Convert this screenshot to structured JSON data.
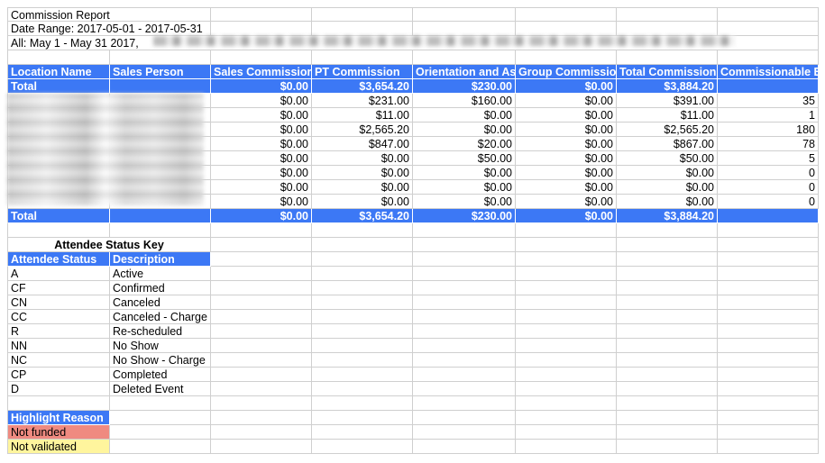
{
  "report": {
    "title": "Commission Report",
    "date_range": "Date Range: 2017-05-01 - 2017-05-31",
    "filter": "All: May 1 - May 31 2017,"
  },
  "commission_table": {
    "headers": [
      "Location Name",
      "Sales Person",
      "Sales Commissior",
      "PT Commission",
      "Orientation and As",
      "Group Commissio",
      "Total Commission",
      "Commissionable E"
    ],
    "total_top": [
      "Total",
      "",
      "$0.00",
      "$3,654.20",
      "$230.00",
      "$0.00",
      "$3,884.20",
      ""
    ],
    "rows": [
      [
        "",
        "",
        "$0.00",
        "$231.00",
        "$160.00",
        "$0.00",
        "$391.00",
        "35"
      ],
      [
        "",
        "",
        "$0.00",
        "$11.00",
        "$0.00",
        "$0.00",
        "$11.00",
        "1"
      ],
      [
        "",
        "",
        "$0.00",
        "$2,565.20",
        "$0.00",
        "$0.00",
        "$2,565.20",
        "180"
      ],
      [
        "",
        "",
        "$0.00",
        "$847.00",
        "$20.00",
        "$0.00",
        "$867.00",
        "78"
      ],
      [
        "",
        "",
        "$0.00",
        "$0.00",
        "$50.00",
        "$0.00",
        "$50.00",
        "5"
      ],
      [
        "",
        "",
        "$0.00",
        "$0.00",
        "$0.00",
        "$0.00",
        "$0.00",
        "0"
      ],
      [
        "",
        "",
        "$0.00",
        "$0.00",
        "$0.00",
        "$0.00",
        "$0.00",
        "0"
      ],
      [
        "",
        "",
        "$0.00",
        "$0.00",
        "$0.00",
        "$0.00",
        "$0.00",
        "0"
      ]
    ],
    "total_bottom": [
      "Total",
      "",
      "$0.00",
      "$3,654.20",
      "$230.00",
      "$0.00",
      "$3,884.20",
      ""
    ]
  },
  "status_key": {
    "title": "Attendee Status Key",
    "headers": [
      "Attendee Status",
      "Description"
    ],
    "rows": [
      [
        "A",
        "Active"
      ],
      [
        "CF",
        "Confirmed"
      ],
      [
        "CN",
        "Canceled"
      ],
      [
        "CC",
        "Canceled - Charge"
      ],
      [
        "R",
        "Re-scheduled"
      ],
      [
        "NN",
        "No Show"
      ],
      [
        "NC",
        "No Show - Charge"
      ],
      [
        "CP",
        "Completed"
      ],
      [
        "D",
        "Deleted Event"
      ]
    ]
  },
  "highlight": {
    "header": "Highlight Reason",
    "items": [
      {
        "label": "Not funded",
        "color": "#ef8a80"
      },
      {
        "label": "Not validated",
        "color": "#fff59d"
      }
    ]
  },
  "colors": {
    "header_blue": "#3c78f5",
    "gridline": "#cfcfcf"
  }
}
